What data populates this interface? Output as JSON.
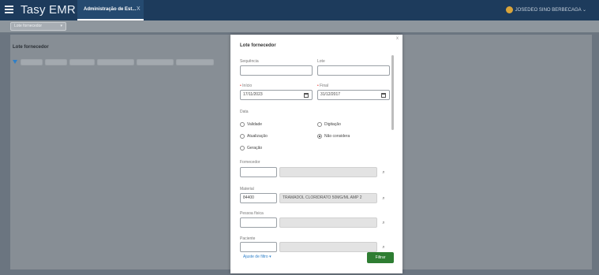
{
  "header": {
    "app_name": "Tasy EMR",
    "tab_label": "Administração de Est...",
    "tab_close": "X",
    "user_name": "JOSEDEO SINO BERBECAGA"
  },
  "subheader": {
    "chip_label": "Lote fornecedor"
  },
  "panel": {
    "title": "Lote fornecedor"
  },
  "dialog": {
    "title": "Lote fornecedor",
    "close": "x",
    "fields": {
      "sequencia": {
        "label": "Sequência",
        "value": ""
      },
      "lote": {
        "label": "Lote",
        "value": ""
      },
      "inicio": {
        "label": "Início",
        "value": "17/11/2023"
      },
      "final": {
        "label": "Final",
        "value": "31/12/2017"
      },
      "fornecedor": {
        "label": "Fornecedor",
        "code": "",
        "name": ""
      },
      "material": {
        "label": "Material",
        "code": "84400",
        "name": "TRAMADOL CLORIDRATO 50MG/ML AMP 2"
      },
      "pessoa_fisica": {
        "label": "Pessoa física",
        "code": "",
        "name": ""
      },
      "paciente": {
        "label": "Paciente",
        "code": "",
        "name": ""
      }
    },
    "data_section_label": "Data",
    "date_options": [
      {
        "label": "Validade",
        "selected": false
      },
      {
        "label": "Digitação",
        "selected": false
      },
      {
        "label": "Atualização",
        "selected": false
      },
      {
        "label": "Não considera",
        "selected": true
      },
      {
        "label": "Geração",
        "selected": false
      }
    ],
    "more_filters": "Ajuste de filtro",
    "filter_button": "Filtrar"
  },
  "colors": {
    "header": "#1d3b5c",
    "accent": "#2e7fc8",
    "primary_button": "#2e7d32",
    "required": "#e53935"
  }
}
